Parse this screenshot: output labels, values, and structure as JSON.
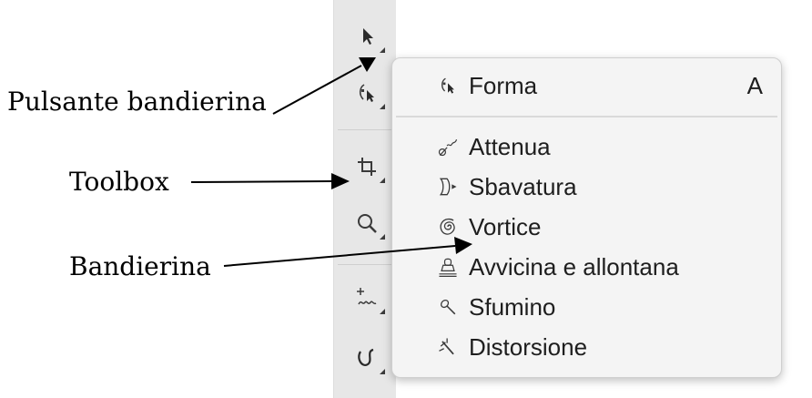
{
  "callouts": {
    "flag_button": "Pulsante bandierina",
    "toolbox": "Toolbox",
    "flyout": "Bandierina"
  },
  "toolbox": {
    "tools": [
      {
        "icon": "pick-arrow-icon"
      },
      {
        "icon": "shape-tool-icon"
      },
      {
        "icon": "crop-icon"
      },
      {
        "icon": "zoom-icon"
      },
      {
        "icon": "freehand-icon"
      },
      {
        "icon": "curve-icon"
      }
    ]
  },
  "flyout": {
    "items": [
      {
        "label": "Forma",
        "shortcut": "A",
        "icon": "shape-tool-icon"
      },
      {
        "label": "Attenua",
        "icon": "smooth-icon"
      },
      {
        "label": "Sbavatura",
        "icon": "smear-icon"
      },
      {
        "label": "Vortice",
        "icon": "twirl-icon"
      },
      {
        "label": "Avvicina e allontana",
        "icon": "attract-repel-icon"
      },
      {
        "label": "Sfumino",
        "icon": "smudge-icon"
      },
      {
        "label": "Distorsione",
        "icon": "roughen-icon"
      }
    ]
  },
  "colors": {
    "toolbox_bg": "#e7e7e7",
    "flyout_bg": "#f4f4f4",
    "text": "#1e1e1e"
  }
}
